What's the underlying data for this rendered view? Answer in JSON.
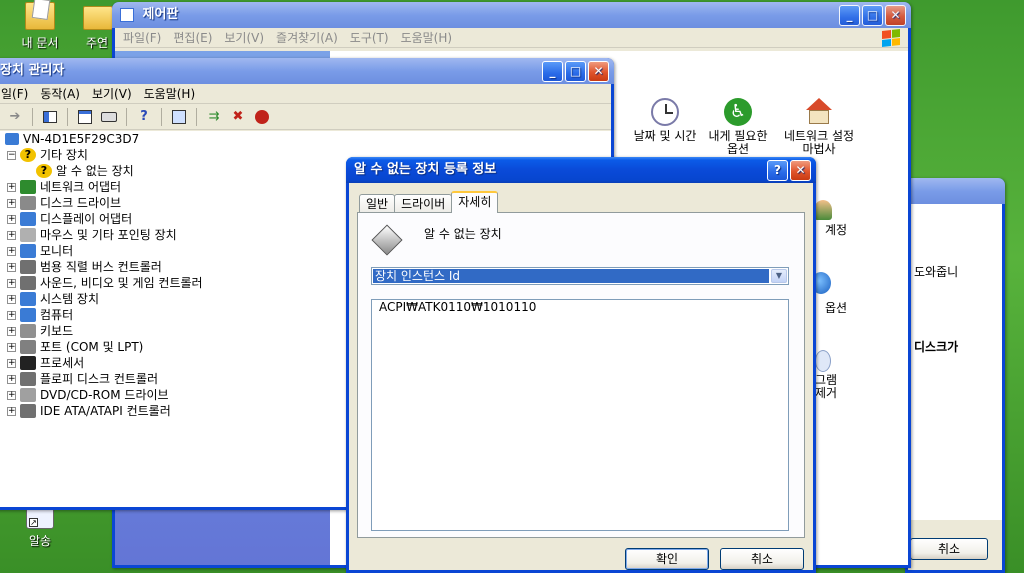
{
  "desktop": {
    "icons": [
      {
        "label": "내 문서",
        "icon": "my-documents-icon"
      },
      {
        "label": "주연",
        "icon": "folder-icon"
      },
      {
        "label": "알송",
        "icon": "alsong-icon"
      }
    ]
  },
  "control_panel": {
    "title": "제어판",
    "menu": [
      "파일(F)",
      "편집(E)",
      "보기(V)",
      "즐겨찾기(A)",
      "도구(T)",
      "도움말(H)"
    ],
    "items": [
      {
        "label": "날짜 및 시간",
        "icon": "clock-icon"
      },
      {
        "label": "내게 필요한 옵션",
        "icon": "accessibility-icon"
      },
      {
        "label": "네트워크 설정 마법사",
        "icon": "network-house-icon"
      },
      {
        "label": "계정",
        "icon": "user-accounts-icon"
      },
      {
        "label": "옵션",
        "icon": "regional-globe-icon"
      },
      {
        "label": "그램 제거",
        "icon": "add-remove-programs-icon"
      }
    ]
  },
  "behind_window": {
    "text1": "도와줍니",
    "text2": "디스크가",
    "cancel_label": "취소"
  },
  "device_manager": {
    "title": "장치 관리자",
    "menu": [
      "일(F)",
      "동작(A)",
      "보기(V)",
      "도움말(H)"
    ],
    "toolbar_icons": [
      "back-arrow-icon",
      "properties-pane-icon",
      "properties-icon",
      "print-icon",
      "help-icon",
      "scan-hardware-icon",
      "update-driver-icon",
      "disable-device-icon",
      "uninstall-device-icon"
    ],
    "root": "VN-4D1E5F29C3D7",
    "tree": [
      {
        "label": "기타 장치",
        "expanded": true,
        "level": 0,
        "icon": "unknown-device-icon",
        "color": "#f2c200"
      },
      {
        "label": "알 수 없는 장치",
        "expanded": null,
        "level": 1,
        "icon": "unknown-device-icon",
        "color": "#f2c200"
      },
      {
        "label": "네트워크 어댑터",
        "expanded": false,
        "level": 0,
        "icon": "network-adapter-icon",
        "color": "#2e8b2e"
      },
      {
        "label": "디스크 드라이브",
        "expanded": false,
        "level": 0,
        "icon": "disk-drive-icon",
        "color": "#8a8a8a"
      },
      {
        "label": "디스플레이 어댑터",
        "expanded": false,
        "level": 0,
        "icon": "display-adapter-icon",
        "color": "#3a7bd5"
      },
      {
        "label": "마우스 및 기타 포인팅 장치",
        "expanded": false,
        "level": 0,
        "icon": "mouse-icon",
        "color": "#b0b0b0"
      },
      {
        "label": "모니터",
        "expanded": false,
        "level": 0,
        "icon": "monitor-icon",
        "color": "#3a7bd5"
      },
      {
        "label": "범용 직렬 버스 컨트롤러",
        "expanded": false,
        "level": 0,
        "icon": "usb-icon",
        "color": "#707070"
      },
      {
        "label": "사운드, 비디오 및 게임 컨트롤러",
        "expanded": false,
        "level": 0,
        "icon": "sound-icon",
        "color": "#707070"
      },
      {
        "label": "시스템 장치",
        "expanded": false,
        "level": 0,
        "icon": "system-device-icon",
        "color": "#3a7bd5"
      },
      {
        "label": "컴퓨터",
        "expanded": false,
        "level": 0,
        "icon": "computer-icon",
        "color": "#3a7bd5"
      },
      {
        "label": "키보드",
        "expanded": false,
        "level": 0,
        "icon": "keyboard-icon",
        "color": "#909090"
      },
      {
        "label": "포트 (COM 및 LPT)",
        "expanded": false,
        "level": 0,
        "icon": "port-icon",
        "color": "#808080"
      },
      {
        "label": "프로세서",
        "expanded": false,
        "level": 0,
        "icon": "processor-icon",
        "color": "#222222"
      },
      {
        "label": "플로피 디스크 컨트롤러",
        "expanded": false,
        "level": 0,
        "icon": "floppy-controller-icon",
        "color": "#707070"
      },
      {
        "label": "DVD/CD-ROM 드라이브",
        "expanded": false,
        "level": 0,
        "icon": "cdrom-icon",
        "color": "#a0a0a0"
      },
      {
        "label": "IDE ATA/ATAPI 컨트롤러",
        "expanded": false,
        "level": 0,
        "icon": "ide-controller-icon",
        "color": "#707070"
      }
    ]
  },
  "dialog": {
    "title": "알 수 없는 장치 등록 정보",
    "tabs": [
      "일반",
      "드라이버",
      "자세히"
    ],
    "active_tab": 2,
    "device_name": "알 수 없는 장치",
    "property_selected": "장치 인스턴스 Id",
    "value": "ACPI₩ATK0110₩1010110",
    "ok_label": "확인",
    "cancel_label": "취소"
  }
}
